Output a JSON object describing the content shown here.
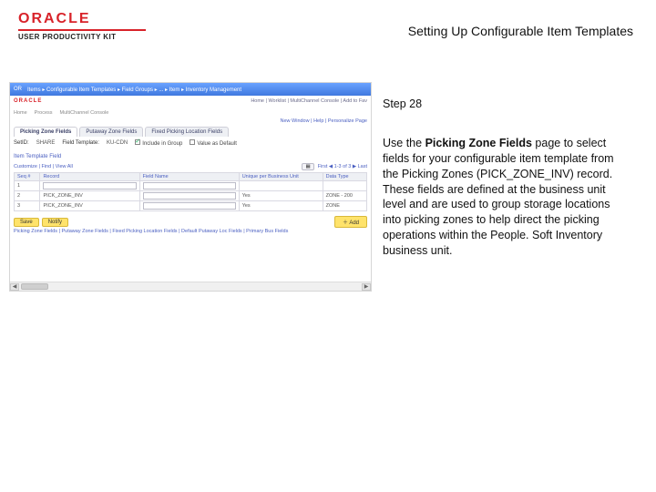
{
  "header": {
    "brand": "ORACLE",
    "subbrand": "USER PRODUCTIVITY KIT",
    "doc_title": "Setting Up Configurable Item Templates"
  },
  "rightcol": {
    "step": "Step 28",
    "body_pre": "Use the ",
    "body_bold": "Picking Zone Fields",
    "body_post": " page to select fields for your configurable item template from the Picking Zones (PICK_ZONE_INV) record. These fields are defined at the business unit level and are used to group storage locations into picking zones to help direct the picking operations within the People. Soft Inventory business unit."
  },
  "shot": {
    "breadcrumb": "Items ▸ Configurable Item Templates ▸ Field Groups ▸ ... ▸ Item ▸ Inventory Management",
    "subbar": "Home | Worklist | MultiChannel Console | Add to Fav",
    "meta": [
      "Home",
      "Process",
      "MultiChannel Console"
    ],
    "save_links": "New Window | Help | Personalize Page",
    "tabs": [
      "Picking Zone Fields",
      "Putaway Zone Fields",
      "Fixed Picking Location Fields"
    ],
    "active_tab": 0,
    "form": {
      "setid_lbl": "SetID:",
      "setid_val": "SHARE",
      "template_lbl": "Field Template:",
      "template_val": "KU-CDN",
      "chk1_lbl": "Include in Group",
      "chk2_lbl": "Value as Default"
    },
    "section": "Item Template Field",
    "grid_ctrl": {
      "customize": "Customize | Find | View All",
      "range": "First ◀ 1-3 of 3 ▶ Last"
    },
    "columns": [
      "Seq #",
      "Record",
      "Field Name",
      "Unique per Business Unit",
      "Data Type"
    ],
    "rows": [
      {
        "seq": "1",
        "record": "",
        "field": "",
        "uniq": "",
        "type": ""
      },
      {
        "seq": "2",
        "record": "PICK_ZONE_INV",
        "field": "",
        "uniq": "Yes",
        "type": "ZONE - 200"
      },
      {
        "seq": "3",
        "record": "PICK_ZONE_INV",
        "field": "",
        "uniq": "Yes",
        "type": "ZONE"
      }
    ],
    "pager": {
      "save": "Save",
      "notify": "Notify",
      "add": "Add"
    },
    "footlinks": "Picking Zone Fields | Putaway Zone Fields | Fixed Picking Location Fields | Default Putaway Loc Fields | Primary Bus Fields"
  }
}
